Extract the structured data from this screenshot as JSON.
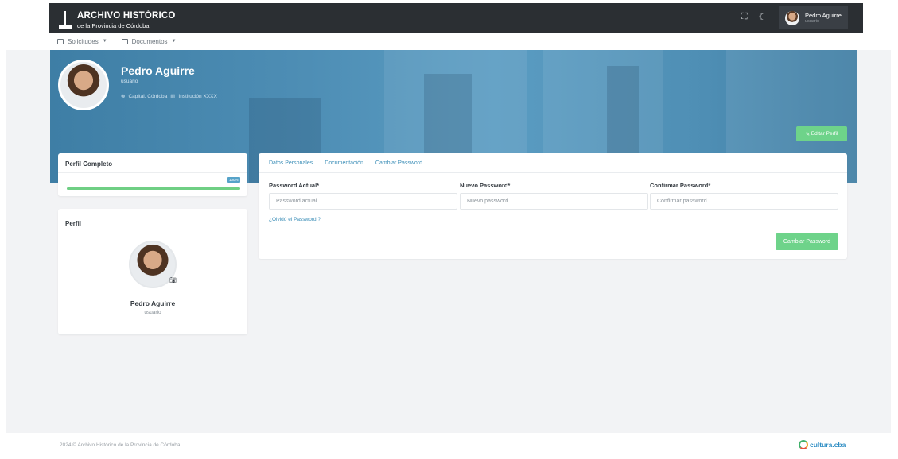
{
  "header": {
    "logo_line1": "ARCHIVO HISTÓRICO",
    "logo_line2": "de la Provincia de Córdoba",
    "user_name": "Pedro Aguirre",
    "user_role": "usuario"
  },
  "menu": {
    "items": [
      {
        "label": "Solicitudes",
        "icon": "inbox-icon"
      },
      {
        "label": "Documentos",
        "icon": "document-icon"
      }
    ]
  },
  "cover": {
    "name": "Pedro Aguirre",
    "role": "usuario",
    "location": "Capital, Córdoba",
    "institution": "Institución XXXX",
    "edit_label": "Editar Perfil"
  },
  "profile_complete": {
    "title": "Perfil Completo",
    "percent_label": "100%",
    "percent": 100
  },
  "profile_card": {
    "title": "Perfil",
    "name": "Pedro Aguirre",
    "role": "usuario"
  },
  "tabs": [
    {
      "label": "Datos Personales"
    },
    {
      "label": "Documentación"
    },
    {
      "label": "Cambiar Password"
    }
  ],
  "form": {
    "current": {
      "label": "Password Actual*",
      "placeholder": "Password actual"
    },
    "new": {
      "label": "Nuevo Password*",
      "placeholder": "Nuevo password"
    },
    "confirm": {
      "label": "Confirmar Password*",
      "placeholder": "Confirmar password"
    },
    "forgot_link": "¿Olvidó el Password ?",
    "submit_label": "Cambiar Password"
  },
  "footer": {
    "copyright": "2024 © Archivo Histórico de la Provincia de Córdoba.",
    "brand": "cultura.cba"
  },
  "colors": {
    "topbar": "#2b2f33",
    "accent": "#3d8fb8",
    "success": "#6ed38a"
  }
}
